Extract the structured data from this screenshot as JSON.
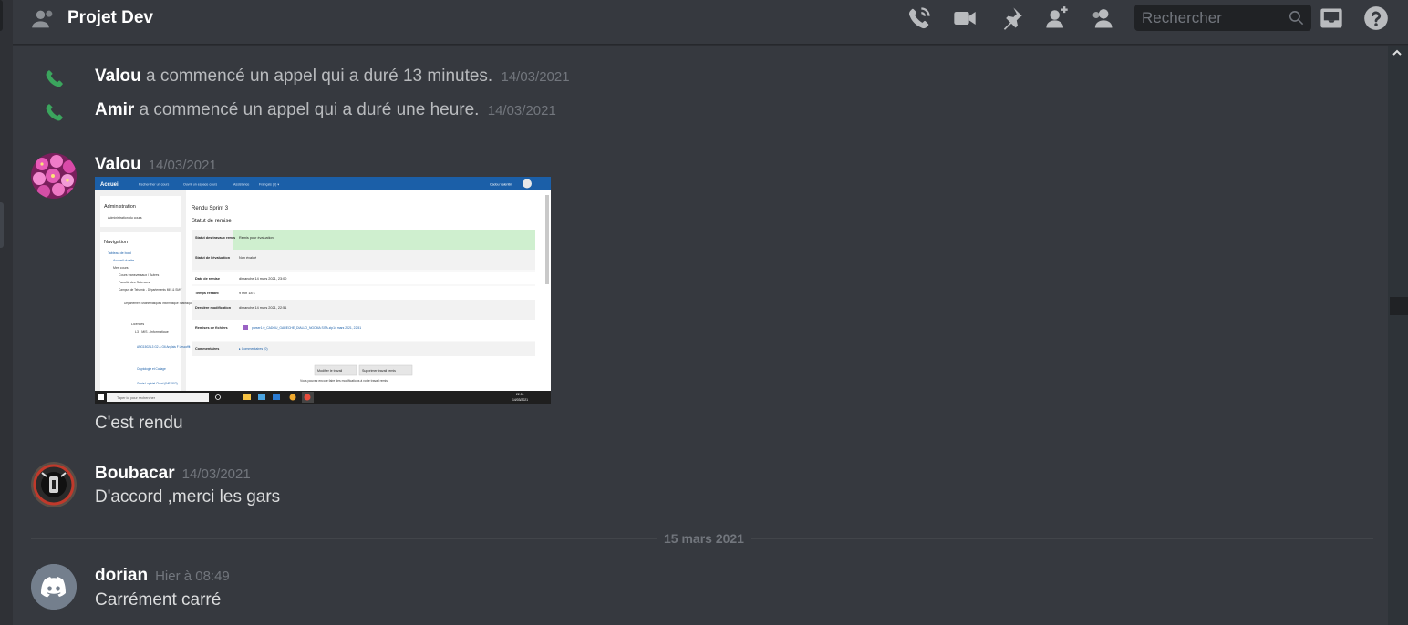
{
  "header": {
    "channel_name": "Projet Dev",
    "search_placeholder": "Rechercher",
    "icons": [
      "people-icon",
      "call-icon",
      "video-icon",
      "pin-icon",
      "add-member-icon",
      "member-list-icon",
      "search-icon",
      "inbox-icon",
      "help-icon"
    ]
  },
  "colors": {
    "background": "#36393f",
    "header_bg": "#36393f",
    "search_bg": "#202225",
    "call_green": "#3ba55d",
    "white_text": "#ffffff",
    "muted_text": "#72767d",
    "body_text": "#dcddde",
    "discord_blurple": "#5865f2"
  },
  "messages": {
    "call1": {
      "user": "Valou",
      "text": "a commencé un appel qui a duré 13 minutes.",
      "timestamp": "14/03/2021"
    },
    "call2": {
      "user": "Amir",
      "text": "a commencé un appel qui a duré une heure.",
      "timestamp": "14/03/2021"
    },
    "valou": {
      "author": "Valou",
      "timestamp": "14/03/2021",
      "text": "C'est rendu",
      "attachment": {
        "topbar_home": "Accueil",
        "topbar_links": [
          "Rechercher un cours",
          "Ouvrir un espace cours",
          "Assistance",
          "Français (fr) ▾"
        ],
        "topbar_user": "Cadou Valentin",
        "sidebar": {
          "admin_title": "Administration",
          "admin_item": "Administration du cours",
          "nav_title": "Navigation",
          "nav_items": [
            "Tableau de bord",
            "Accueil du site",
            "Mes cours",
            "Cours transversaux / Autres",
            "Faculté des Sciences",
            "Campus de Tehamic - Départements MIS & SMV",
            "Département Mathématiques Informatique Statistique",
            "Licences",
            "L3 - MIS - Informatique",
            "ANG1502 L3 G2 & G6 Anglais F Lescoffit",
            "Cryptologie et Codage",
            "Génie Logiciel Cloud (INF1502)"
          ]
        },
        "page_title": "Rendu Sprint 3",
        "section_title": "Statut de remise",
        "rows": [
          {
            "label": "Statut des travaux remis",
            "value": "Remis pour évaluation"
          },
          {
            "label": "Statut de l'évaluation",
            "value": "Non évalué"
          },
          {
            "label": "Date de remise",
            "value": "dimanche 14 mars 2021, 23:00"
          },
          {
            "label": "Temps restant",
            "value": "9 min 18 s"
          },
          {
            "label": "Dernière modification",
            "value": "dimanche 14 mars 2021, 22:51"
          },
          {
            "label": "Remises de fichiers",
            "value": "parser1.0_CADOU_GARECHE_DIALLO_NGOMA SITA.zip14 mars 2021, 22:51"
          },
          {
            "label": "Commentaires",
            "value": "▸ Commentaires (0)"
          }
        ],
        "edit_button": "Modifier le travail",
        "delete_button": "Supprimer travail remis",
        "note": "Vous pouvez encore faire des modifications à votre travail remis.",
        "taskbar_search": "Taper ici pour rechercher",
        "taskbar_time": "22:51",
        "taskbar_date": "14/03/2021"
      }
    },
    "boubacar": {
      "author": "Boubacar",
      "timestamp": "14/03/2021",
      "text": "D'accord ,merci les gars"
    },
    "date_divider": "15 mars 2021",
    "dorian": {
      "author": "dorian",
      "timestamp": "Hier à 08:49",
      "text": "Carrément carré"
    }
  }
}
